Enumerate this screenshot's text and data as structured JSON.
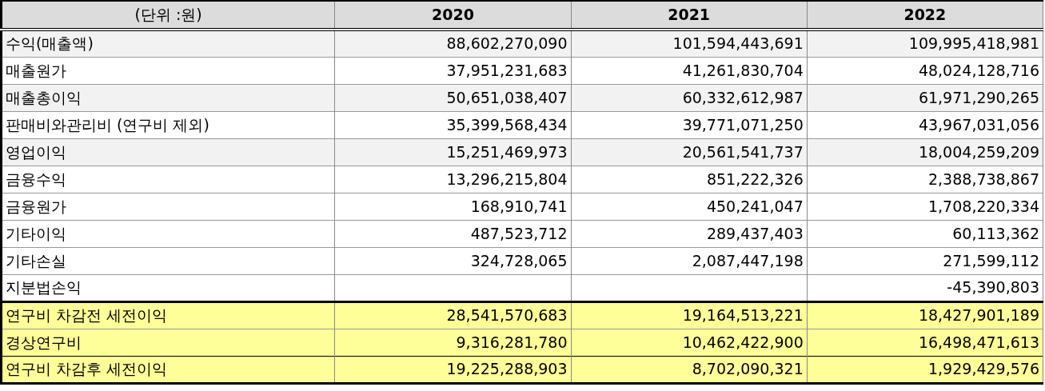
{
  "table": {
    "columns": [
      "(단위  :원)",
      "2020",
      "2021",
      "2022"
    ],
    "rows": [
      {
        "kind": "shaded",
        "cells": [
          "수익(매출액)",
          "88,602,270,090",
          "101,594,443,691",
          "109,995,418,981"
        ]
      },
      {
        "kind": "plain",
        "cells": [
          "매출원가",
          "37,951,231,683",
          "41,261,830,704",
          "48,024,128,716"
        ]
      },
      {
        "kind": "shaded",
        "cells": [
          "매출총이익",
          "50,651,038,407",
          "60,332,612,987",
          "61,971,290,265"
        ]
      },
      {
        "kind": "plain",
        "cells": [
          "판매비와관리비 (연구비 제외)",
          "35,399,568,434",
          "39,771,071,250",
          "43,967,031,056"
        ]
      },
      {
        "kind": "shaded",
        "cells": [
          "영업이익",
          "15,251,469,973",
          "20,561,541,737",
          "18,004,259,209"
        ]
      },
      {
        "kind": "plain",
        "cells": [
          "금융수익",
          "13,296,215,804",
          "851,222,326",
          "2,388,738,867"
        ]
      },
      {
        "kind": "plain",
        "cells": [
          "금융원가",
          "168,910,741",
          "450,241,047",
          "1,708,220,334"
        ]
      },
      {
        "kind": "plain",
        "cells": [
          "기타이익",
          "487,523,712",
          "289,437,403",
          "60,113,362"
        ]
      },
      {
        "kind": "plain",
        "cells": [
          "기타손실",
          "324,728,065",
          "2,087,447,198",
          "271,599,112"
        ]
      },
      {
        "kind": "plain",
        "cells": [
          "지분법손익",
          null,
          null,
          "-45,390,803"
        ]
      },
      {
        "kind": "highlight",
        "cells": [
          "연구비 차감전 세전이익",
          "28,541,570,683",
          "19,164,513,221",
          "18,427,901,189"
        ]
      },
      {
        "kind": "highlight",
        "cells": [
          "경상연구비",
          "9,316,281,780",
          "10,462,422,900",
          "16,498,471,613"
        ]
      },
      {
        "kind": "highlight",
        "cells": [
          "연구비 차감후 세전이익",
          "19,225,288,903",
          "8,702,090,321",
          "1,929,429,576"
        ]
      }
    ]
  }
}
